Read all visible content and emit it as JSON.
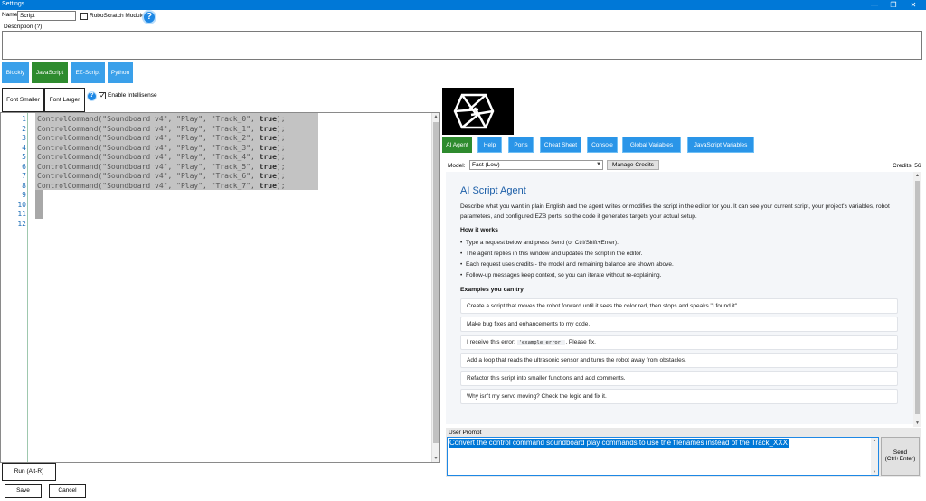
{
  "window": {
    "title": "Settings",
    "controls": [
      "—",
      "❐",
      "✕"
    ]
  },
  "name": {
    "label": "Name",
    "value": "Script"
  },
  "robo_scratch": {
    "label": "RoboScratch Module",
    "checked": false
  },
  "help_icon": "?",
  "description": {
    "label": "Description (?)",
    "value": ""
  },
  "lang_buttons": [
    {
      "label": "Blockly",
      "color": "#3aa0ea"
    },
    {
      "label": "JavaScript",
      "color": "#2e8b2e"
    },
    {
      "label": "EZ-Script",
      "color": "#3aa0ea"
    },
    {
      "label": "Python",
      "color": "#3aa0ea"
    }
  ],
  "font_smaller": "Font Smaller",
  "font_larger": "Font Larger",
  "intellisense": {
    "label": "Enable Intellisense",
    "checked": true
  },
  "editor": {
    "line_numbers": [
      "1",
      "2",
      "3",
      "4",
      "5",
      "6",
      "7",
      "8",
      "9",
      "10",
      "11",
      "12"
    ],
    "lines": [
      {
        "code": "ControlCommand(\"Soundboard v4\", \"Play\", \"Track_0\", ",
        "kw": "true",
        "end": ");"
      },
      {
        "code": "ControlCommand(\"Soundboard v4\", \"Play\", \"Track_1\", ",
        "kw": "true",
        "end": ");"
      },
      {
        "code": "ControlCommand(\"Soundboard v4\", \"Play\", \"Track_2\", ",
        "kw": "true",
        "end": ");"
      },
      {
        "code": "ControlCommand(\"Soundboard v4\", \"Play\", \"Track_3\", ",
        "kw": "true",
        "end": ");"
      },
      {
        "code": "ControlCommand(\"Soundboard v4\", \"Play\", \"Track_4\", ",
        "kw": "true",
        "end": ");"
      },
      {
        "code": "ControlCommand(\"Soundboard v4\", \"Play\", \"Track_5\", ",
        "kw": "true",
        "end": ");"
      },
      {
        "code": "ControlCommand(\"Soundboard v4\", \"Play\", \"Track_6\", ",
        "kw": "true",
        "end": ");"
      },
      {
        "code": "ControlCommand(\"Soundboard v4\", \"Play\", \"Track_7\", ",
        "kw": "true",
        "end": ");"
      }
    ]
  },
  "run_button": "Run (Alt-R)",
  "save_button": "Save",
  "cancel_button": "Cancel",
  "tabs": [
    "AI Agent",
    "Help",
    "Ports",
    "Cheat Sheet",
    "Console",
    "Global Variables",
    "JavaScript Variables"
  ],
  "model": {
    "label": "Model:",
    "value": "Fast (Low)"
  },
  "manage_credits": "Manage Credits",
  "credits": "Credits: 56",
  "agent": {
    "title": "AI Script Agent",
    "description": "Describe what you want in plain English and the agent writes or modifies the script in the editor for you. It can see your current script, your project's variables, robot parameters, and configured EZB ports, so the code it generates targets your actual setup.",
    "how_title": "How it works",
    "how_items": [
      "Type a request below and press Send (or Ctrl/Shift+Enter).",
      "The agent replies in this window and updates the script in the editor.",
      "Each request uses credits - the model and remaining balance are shown above.",
      "Follow-up messages keep context, so you can iterate without re-explaining."
    ],
    "examples_title": "Examples you can try",
    "examples": [
      "Create a script that moves the robot forward until it sees the color red, then stops and speaks \"I found it\".",
      "Make bug fixes and enhancements to my code.",
      "I receive this error:",
      "Add a loop that reads the ultrasonic sensor and turns the robot away from obstacles.",
      "Refactor this script into smaller functions and add comments.",
      "Why isn't my servo moving? Check the logic and fix it."
    ],
    "example_error_code": "'example error'",
    "example_error_suffix": ". Please fix."
  },
  "user_prompt": {
    "label": "User Prompt",
    "value": "Convert the control command soundboard play commands to use the filenames instead of the Track_XXX"
  },
  "send_button": {
    "line1": "Send",
    "line2": "(Ctrl+Enter)"
  }
}
